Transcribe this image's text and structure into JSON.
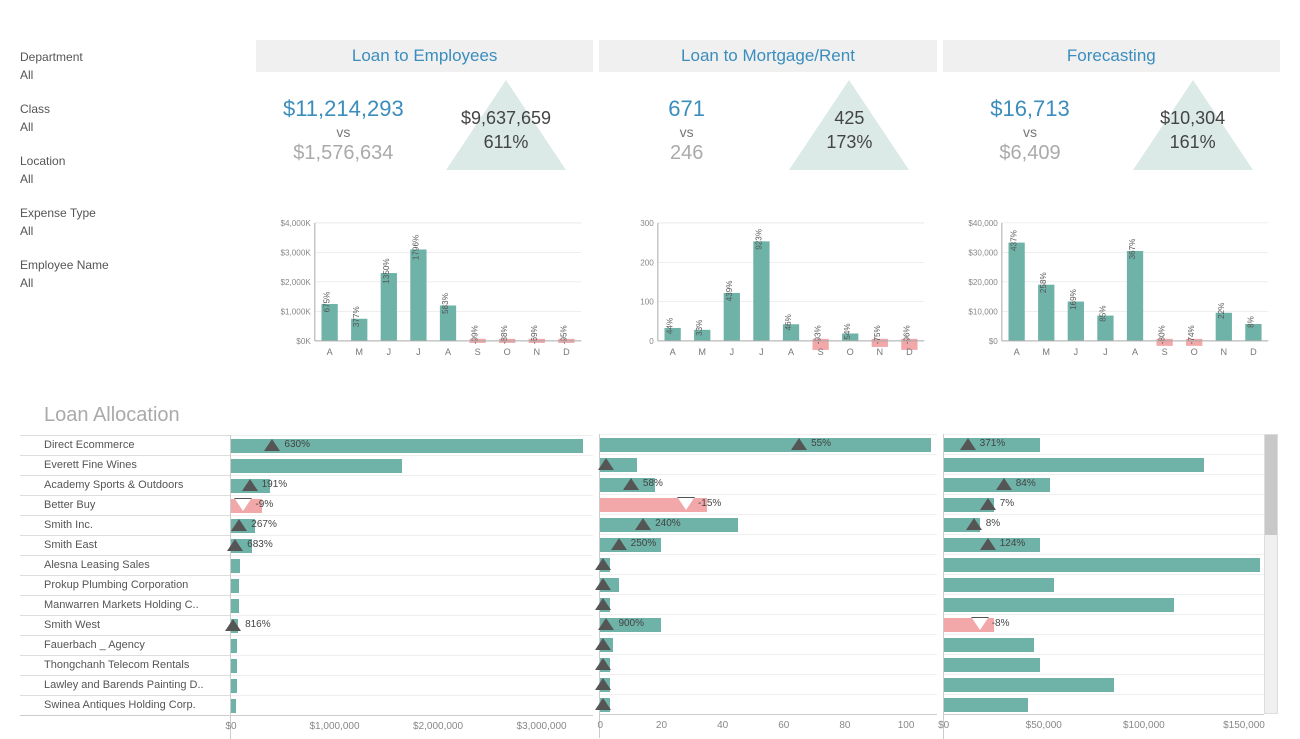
{
  "filters": [
    {
      "label": "Department",
      "value": "All"
    },
    {
      "label": "Class",
      "value": "All"
    },
    {
      "label": "Location",
      "value": "All"
    },
    {
      "label": "Expense Type",
      "value": "All"
    },
    {
      "label": "Employee Name",
      "value": "All"
    }
  ],
  "panels": [
    {
      "title": "Loan to Employees",
      "main": "$11,214,293",
      "vs": "vs",
      "prev": "$1,576,634",
      "diff": "$9,637,659",
      "pct": "611%"
    },
    {
      "title": "Loan to Mortgage/Rent",
      "main": "671",
      "vs": "vs",
      "prev": "246",
      "diff": "425",
      "pct": "173%"
    },
    {
      "title": "Forecasting",
      "main": "$16,713",
      "vs": "vs",
      "prev": "$6,409",
      "diff": "$10,304",
      "pct": "161%"
    }
  ],
  "alloc_title": "Loan Allocation",
  "alloc_rows": [
    "Direct Ecommerce",
    "Everett Fine Wines",
    "Academy Sports & Outdoors",
    "Better Buy",
    "Smith Inc.",
    "Smith East",
    "Alesna Leasing Sales",
    "Prokup Plumbing Corporation",
    "Manwarren Markets Holding C..",
    "Smith West",
    "Fauerbach _ Agency",
    "Thongchanh Telecom Rentals",
    "Lawley and Barends Painting D..",
    "Swinea Antiques Holding Corp."
  ],
  "chart_data": {
    "monthly": [
      {
        "type": "bar",
        "title": "Loan to Employees monthly",
        "yformat": "$,K",
        "ylim": [
          0,
          4000
        ],
        "yticks": [
          "$0K",
          "$1,000K",
          "$2,000K",
          "$3,000K",
          "$4,000K"
        ],
        "categories": [
          "A",
          "M",
          "J",
          "J",
          "A",
          "S",
          "O",
          "N",
          "D"
        ],
        "values": [
          1250,
          750,
          2300,
          3100,
          1200,
          -100,
          -120,
          -90,
          -100
        ],
        "labels": [
          "675%",
          "377%",
          "1350%",
          "1796%",
          "583%",
          "-99%",
          "-88%",
          "-69%",
          "-95%"
        ]
      },
      {
        "type": "bar",
        "title": "Loan to Mortgage/Rent monthly",
        "ylim": [
          0,
          320
        ],
        "yticks": [
          "0",
          "100",
          "200",
          "300"
        ],
        "categories": [
          "A",
          "M",
          "J",
          "J",
          "A",
          "S",
          "O",
          "N",
          "D"
        ],
        "values": [
          35,
          30,
          130,
          270,
          45,
          -30,
          20,
          -22,
          -30
        ],
        "labels": [
          "44%",
          "33%",
          "439%",
          "923%",
          "46%",
          "-93%",
          "54%",
          "-75%",
          "-96%"
        ]
      },
      {
        "type": "bar",
        "title": "Forecasting monthly",
        "yformat": "$,",
        "ylim": [
          0,
          42000
        ],
        "yticks": [
          "$0",
          "$10,000",
          "$20,000",
          "$30,000",
          "$40,000"
        ],
        "categories": [
          "A",
          "M",
          "J",
          "J",
          "A",
          "S",
          "O",
          "N",
          "D"
        ],
        "values": [
          35000,
          20000,
          14000,
          9000,
          32000,
          -2500,
          -2500,
          10000,
          6000
        ],
        "labels": [
          "437%",
          "258%",
          "169%",
          "85%",
          "367%",
          "-80%",
          "-74%",
          "22%",
          "8%"
        ]
      }
    ],
    "allocation": [
      {
        "type": "bar_h",
        "title": "Loan Allocation - Loan to Employees",
        "xlim": [
          0,
          3500000
        ],
        "xticks": [
          "$0",
          "$1,000,000",
          "$2,000,000",
          "$3,000,000"
        ],
        "series": [
          {
            "name": "Direct Ecommerce",
            "value": 3400000,
            "pct": "630%",
            "dir": "up",
            "tri": 400000
          },
          {
            "name": "Everett Fine Wines",
            "value": 1650000,
            "pct": null
          },
          {
            "name": "Academy Sports & Outdoors",
            "value": 380000,
            "pct": "191%",
            "dir": "up",
            "tri": 180000
          },
          {
            "name": "Better Buy",
            "value": 300000,
            "pct": "-9%",
            "dir": "down",
            "neg": true,
            "tri": 120000
          },
          {
            "name": "Smith Inc.",
            "value": 230000,
            "pct": "267%",
            "dir": "up",
            "tri": 80000
          },
          {
            "name": "Smith East",
            "value": 200000,
            "pct": "683%",
            "dir": "up",
            "tri": 40000
          },
          {
            "name": "Alesna Leasing Sales",
            "value": 90000,
            "pct": null
          },
          {
            "name": "Prokup Plumbing Corporation",
            "value": 80000,
            "pct": null
          },
          {
            "name": "Manwarren Markets Holding C..",
            "value": 80000,
            "pct": null
          },
          {
            "name": "Smith West",
            "value": 70000,
            "pct": "816%",
            "dir": "up",
            "tri": 20000
          },
          {
            "name": "Fauerbach _ Agency",
            "value": 60000,
            "pct": null
          },
          {
            "name": "Thongchanh Telecom Rentals",
            "value": 55000,
            "pct": null
          },
          {
            "name": "Lawley and Barends Painting D..",
            "value": 55000,
            "pct": null
          },
          {
            "name": "Swinea Antiques Holding Corp.",
            "value": 50000,
            "pct": null
          }
        ]
      },
      {
        "type": "bar_h",
        "title": "Loan Allocation - Loan to Mortgage/Rent",
        "xlim": [
          0,
          110
        ],
        "xticks": [
          "0",
          "20",
          "40",
          "60",
          "80",
          "100"
        ],
        "series": [
          {
            "name": "Direct Ecommerce",
            "value": 108,
            "pct": "55%",
            "dir": "up",
            "tri": 65
          },
          {
            "name": "Everett Fine Wines",
            "value": 12,
            "pct": null,
            "dir": "up",
            "tri": 2
          },
          {
            "name": "Academy Sports & Outdoors",
            "value": 18,
            "pct": "58%",
            "dir": "up",
            "tri": 10
          },
          {
            "name": "Better Buy",
            "value": 35,
            "pct": "-15%",
            "dir": "down",
            "neg": true,
            "tri": 28
          },
          {
            "name": "Smith Inc.",
            "value": 45,
            "pct": "240%",
            "dir": "up",
            "tri": 14
          },
          {
            "name": "Smith East",
            "value": 20,
            "pct": "250%",
            "dir": "up",
            "tri": 6
          },
          {
            "name": "Alesna Leasing Sales",
            "value": 3,
            "pct": null,
            "dir": "up",
            "tri": 1
          },
          {
            "name": "Prokup Plumbing Corporation",
            "value": 6,
            "pct": null,
            "dir": "up",
            "tri": 1
          },
          {
            "name": "Manwarren Markets Holding C..",
            "value": 3,
            "pct": null,
            "dir": "up",
            "tri": 1
          },
          {
            "name": "Smith West",
            "value": 20,
            "pct": "900%",
            "dir": "up",
            "tri": 2
          },
          {
            "name": "Fauerbach _ Agency",
            "value": 4,
            "pct": null,
            "dir": "up",
            "tri": 1
          },
          {
            "name": "Thongchanh Telecom Rentals",
            "value": 3,
            "pct": null,
            "dir": "up",
            "tri": 1
          },
          {
            "name": "Lawley and Barends Painting D..",
            "value": 3,
            "pct": null,
            "dir": "up",
            "tri": 1
          },
          {
            "name": "Swinea Antiques Holding Corp.",
            "value": 3,
            "pct": null,
            "dir": "up",
            "tri": 1
          }
        ]
      },
      {
        "type": "bar_h",
        "title": "Loan Allocation - Forecasting",
        "xlim": [
          0,
          160000
        ],
        "xticks": [
          "$0",
          "$50,000",
          "$100,000",
          "$150,000"
        ],
        "series": [
          {
            "name": "Direct Ecommerce",
            "value": 48000,
            "pct": "371%",
            "dir": "up",
            "tri": 12000
          },
          {
            "name": "Everett Fine Wines",
            "value": 130000,
            "pct": null
          },
          {
            "name": "Academy Sports & Outdoors",
            "value": 53000,
            "pct": "84%",
            "dir": "up",
            "tri": 30000
          },
          {
            "name": "Better Buy",
            "value": 25000,
            "pct": "7%",
            "dir": "up",
            "tri": 22000
          },
          {
            "name": "Smith Inc.",
            "value": 18000,
            "pct": "8%",
            "dir": "up",
            "tri": 15000
          },
          {
            "name": "Smith East",
            "value": 48000,
            "pct": "124%",
            "dir": "up",
            "tri": 22000
          },
          {
            "name": "Alesna Leasing Sales",
            "value": 158000,
            "pct": null
          },
          {
            "name": "Prokup Plumbing Corporation",
            "value": 55000,
            "pct": null
          },
          {
            "name": "Manwarren Markets Holding C..",
            "value": 115000,
            "pct": null
          },
          {
            "name": "Smith West",
            "value": 25000,
            "pct": "-8%",
            "dir": "down",
            "neg": true,
            "tri": 18000
          },
          {
            "name": "Fauerbach _ Agency",
            "value": 45000,
            "pct": null
          },
          {
            "name": "Thongchanh Telecom Rentals",
            "value": 48000,
            "pct": null
          },
          {
            "name": "Lawley and Barends Painting D..",
            "value": 85000,
            "pct": null
          },
          {
            "name": "Swinea Antiques Holding Corp.",
            "value": 42000,
            "pct": null
          }
        ]
      }
    ]
  }
}
